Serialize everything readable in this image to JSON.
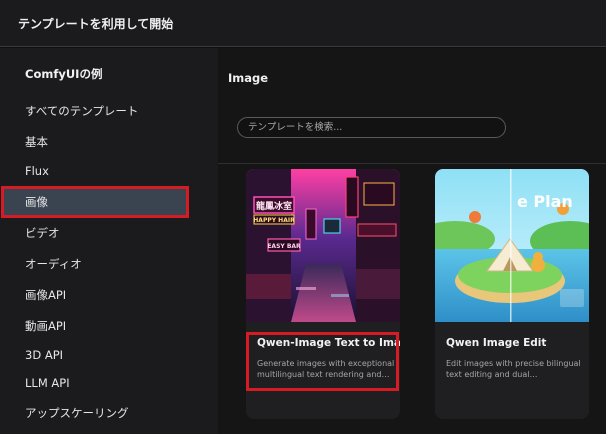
{
  "window": {
    "title": "テンプレートを利用して開始"
  },
  "sidebar": {
    "section_title": "ComfyUIの例",
    "items": [
      {
        "label": "すべてのテンプレート"
      },
      {
        "label": "基本"
      },
      {
        "label": "Flux"
      },
      {
        "label": "画像",
        "active": true
      },
      {
        "label": "ビデオ"
      },
      {
        "label": "オーディオ"
      },
      {
        "label": "画像API"
      },
      {
        "label": "動画API"
      },
      {
        "label": "3D API"
      },
      {
        "label": "LLM API"
      },
      {
        "label": "アップスケーリング"
      }
    ]
  },
  "main": {
    "heading": "Image",
    "search": {
      "placeholder": "テンプレートを検索..."
    },
    "cards": [
      {
        "name": "Qwen-Image Text to Image",
        "description": "Generate images with exceptional multilingual text rendering and…",
        "signs": [
          "龍鳳冰室",
          "HAPPY HAIR",
          "EASY BAR"
        ]
      },
      {
        "name": "Qwen Image Edit",
        "description": "Edit images with precise bilingual text editing and dual…",
        "signs": [
          "e Plan"
        ]
      }
    ]
  },
  "colors": {
    "highlight": "#d51c24",
    "active_bg": "#3a4451"
  }
}
